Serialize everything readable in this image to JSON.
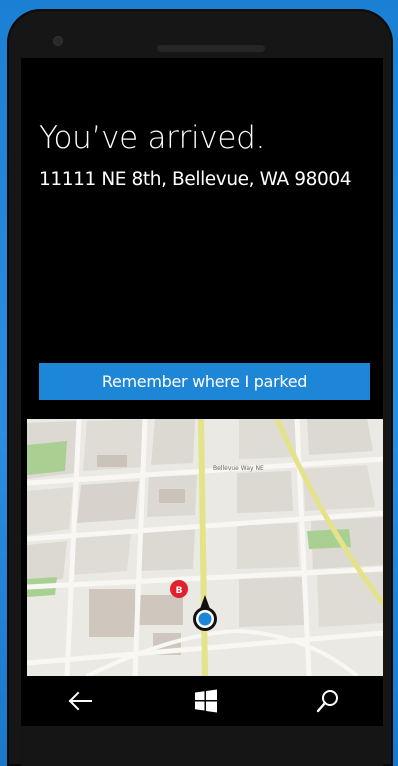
{
  "screen": {
    "title": "You’ve arrived.",
    "address": "11111 NE 8th, Bellevue, WA 98004"
  },
  "actions": {
    "remember_parking_label": "Remember where I parked"
  },
  "map": {
    "parking_marker_letter": "B",
    "street_label": "Bellevue Way NE",
    "location_marker": "current-location",
    "colors": {
      "land": "#ebe9e4",
      "block": "#dcd8d2",
      "building": "#cfc6be",
      "park": "#a9cf93",
      "highway": "#e4e389",
      "parking_marker": "#e1222c",
      "location_dot": "#1e86d7"
    }
  },
  "navbar": {
    "back_icon": "back-arrow-icon",
    "home_icon": "windows-logo-icon",
    "search_icon": "search-icon"
  },
  "colors": {
    "accent": "#1e86d7",
    "background": "#000000",
    "text": "#ffffff"
  }
}
